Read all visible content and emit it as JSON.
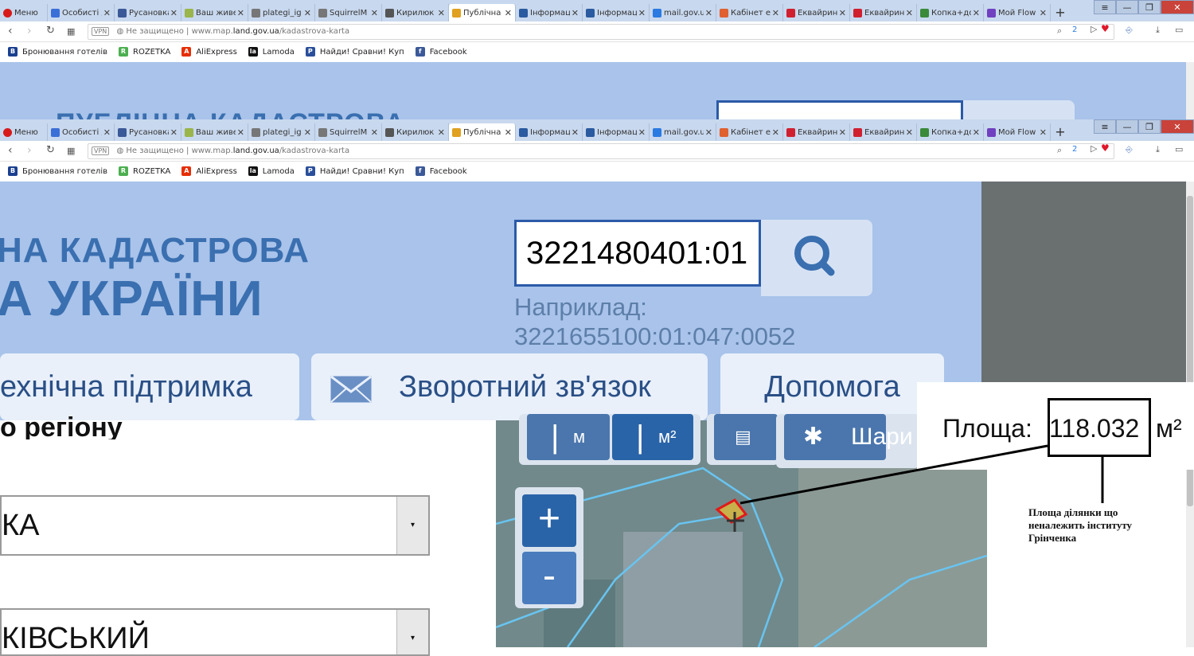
{
  "browser": {
    "menu_label": "Меню",
    "tabs": [
      {
        "label": "Особисті д",
        "color": "#3b6fd8"
      },
      {
        "label": "Русановка",
        "color": "#3b5998"
      },
      {
        "label": "Ваш живе",
        "color": "#9ab54a"
      },
      {
        "label": "plategi_ig",
        "color": "#777777"
      },
      {
        "label": "SquirrelM",
        "color": "#777777"
      },
      {
        "label": "Кирилюк",
        "color": "#555555"
      },
      {
        "label": "Публічна",
        "color": "#e0a020",
        "active": true
      },
      {
        "label": "Інформац",
        "color": "#2a5aa0"
      },
      {
        "label": "Інформац",
        "color": "#2a5aa0"
      },
      {
        "label": "mail.gov.u",
        "color": "#2a7ae2"
      },
      {
        "label": "Кабінет е",
        "color": "#e06030"
      },
      {
        "label": "Еквайрин",
        "color": "#d02030"
      },
      {
        "label": "Еквайрин",
        "color": "#d02030"
      },
      {
        "label": "Копка+до",
        "color": "#3a8a3a"
      },
      {
        "label": "Мой Flow",
        "color": "#7040c0"
      }
    ],
    "new_tab": "+",
    "security_label": "Не защищено",
    "vpn_label": "VPN",
    "url_prefix": "www.map.",
    "url_domain": "land.gov.ua",
    "url_path": "/kadastrova-karta",
    "badge_count": "2",
    "bookmarks": [
      {
        "label": "Бронювання готелів",
        "icon": "B",
        "color": "#1a3f8f"
      },
      {
        "label": "ROZETKA",
        "icon": "R",
        "color": "#4caf50"
      },
      {
        "label": "AliExpress",
        "icon": "A",
        "color": "#e62e04"
      },
      {
        "label": "Lamoda",
        "icon": "la",
        "color": "#111111"
      },
      {
        "label": "Найди! Сравни! Куп",
        "icon": "P",
        "color": "#2a4f9a"
      },
      {
        "label": "Facebook",
        "icon": "f",
        "color": "#3b5998"
      }
    ]
  },
  "page": {
    "logo_line1": "НА КАДАСТРОВА",
    "logo_line2": "А УКРАЇНИ",
    "logo_top_partial": "ПУБЛІЧНА КАДАСТРОВА",
    "search_value": "3221480401:01",
    "example_label": "Наприклад:",
    "example_value": "3221655100:01:047:0052",
    "nav": {
      "support": "ехнічна підтримка",
      "feedback": "Зворотний зв'язок",
      "help": "Допомога"
    },
    "region_label": "о регіону",
    "select1_value": "КА",
    "select2_value": "КІВСЬКИЙ",
    "map_tools": {
      "measure_m": "м",
      "measure_m2": "м²",
      "layers_label": "Шари"
    },
    "zoom_in": "+",
    "zoom_out": "-",
    "area_label": "Площа:",
    "area_value": "118.032",
    "area_unit": "м²",
    "annotation": "Площа ділянки що неналежить інституту Грінченка"
  }
}
